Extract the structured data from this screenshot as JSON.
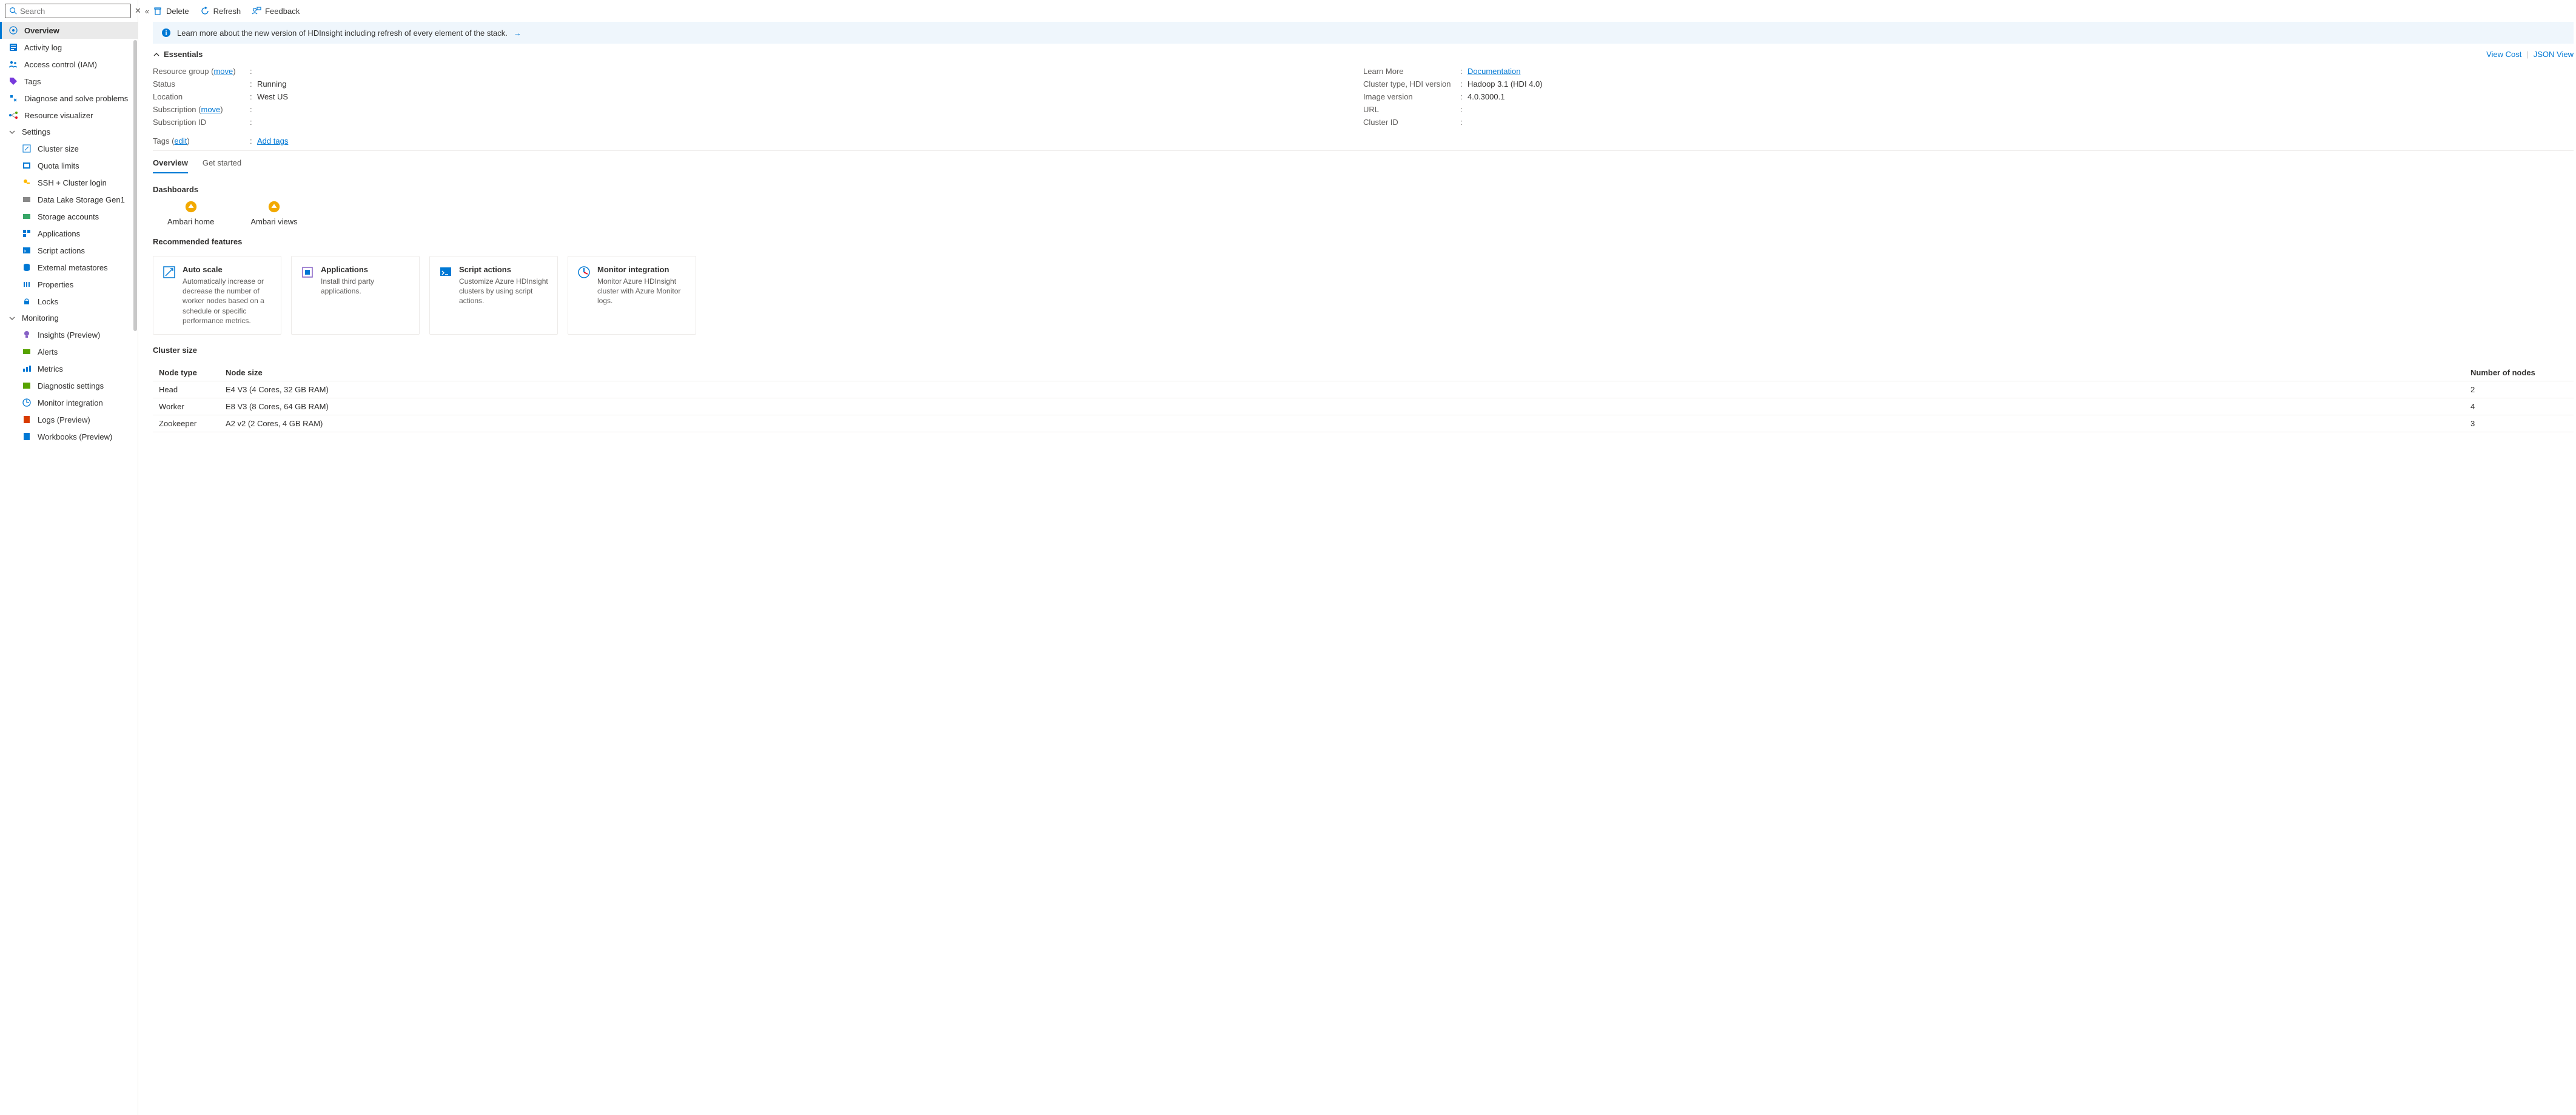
{
  "search": {
    "placeholder": "Search"
  },
  "sidebar": {
    "items": [
      {
        "label": "Overview",
        "selected": true
      },
      {
        "label": "Activity log"
      },
      {
        "label": "Access control (IAM)"
      },
      {
        "label": "Tags"
      },
      {
        "label": "Diagnose and solve problems"
      },
      {
        "label": "Resource visualizer"
      }
    ],
    "settingsGroup": "Settings",
    "settings": [
      {
        "label": "Cluster size"
      },
      {
        "label": "Quota limits"
      },
      {
        "label": "SSH + Cluster login"
      },
      {
        "label": "Data Lake Storage Gen1"
      },
      {
        "label": "Storage accounts"
      },
      {
        "label": "Applications"
      },
      {
        "label": "Script actions"
      },
      {
        "label": "External metastores"
      },
      {
        "label": "Properties"
      },
      {
        "label": "Locks"
      }
    ],
    "monitoringGroup": "Monitoring",
    "monitoring": [
      {
        "label": "Insights (Preview)"
      },
      {
        "label": "Alerts"
      },
      {
        "label": "Metrics"
      },
      {
        "label": "Diagnostic settings"
      },
      {
        "label": "Monitor integration"
      },
      {
        "label": "Logs (Preview)"
      },
      {
        "label": "Workbooks (Preview)"
      }
    ]
  },
  "toolbar": {
    "delete": "Delete",
    "refresh": "Refresh",
    "feedback": "Feedback"
  },
  "infoBar": "Learn more about the new version of HDInsight including refresh of every element of the stack.",
  "essentials": {
    "title": "Essentials",
    "viewCost": "View Cost",
    "jsonView": "JSON View",
    "left": {
      "resourceGroupLabel": "Resource group",
      "moveLabel": "move",
      "statusLabel": "Status",
      "statusValue": "Running",
      "locationLabel": "Location",
      "locationValue": "West US",
      "subscriptionLabel": "Subscription",
      "subscriptionMoveLabel": "move",
      "subscriptionIdLabel": "Subscription ID"
    },
    "right": {
      "learnMoreLabel": "Learn More",
      "documentation": "Documentation",
      "clusterTypeLabel": "Cluster type, HDI version",
      "clusterTypeValue": "Hadoop 3.1 (HDI 4.0)",
      "imageVersionLabel": "Image version",
      "imageVersionValue": "4.0.3000.1",
      "urlLabel": "URL",
      "clusterIdLabel": "Cluster ID"
    },
    "tagsLabel": "Tags",
    "editLabel": "edit",
    "addTags": "Add tags"
  },
  "tabs": {
    "overview": "Overview",
    "getStarted": "Get started"
  },
  "dashboards": {
    "title": "Dashboards",
    "ambariHome": "Ambari home",
    "ambariViews": "Ambari views"
  },
  "features": {
    "title": "Recommended features",
    "cards": [
      {
        "title": "Auto scale",
        "desc": "Automatically increase or decrease the number of worker nodes based on a schedule or specific performance metrics."
      },
      {
        "title": "Applications",
        "desc": "Install third party applications."
      },
      {
        "title": "Script actions",
        "desc": "Customize Azure HDInsight clusters by using script actions."
      },
      {
        "title": "Monitor integration",
        "desc": "Monitor Azure HDInsight cluster with Azure Monitor logs."
      }
    ]
  },
  "clusterSize": {
    "title": "Cluster size",
    "headers": {
      "type": "Node type",
      "size": "Node size",
      "num": "Number of nodes"
    },
    "rows": [
      {
        "type": "Head",
        "size": "E4 V3 (4 Cores, 32 GB RAM)",
        "num": "2"
      },
      {
        "type": "Worker",
        "size": "E8 V3 (8 Cores, 64 GB RAM)",
        "num": "4"
      },
      {
        "type": "Zookeeper",
        "size": "A2 v2 (2 Cores, 4 GB RAM)",
        "num": "3"
      }
    ]
  }
}
